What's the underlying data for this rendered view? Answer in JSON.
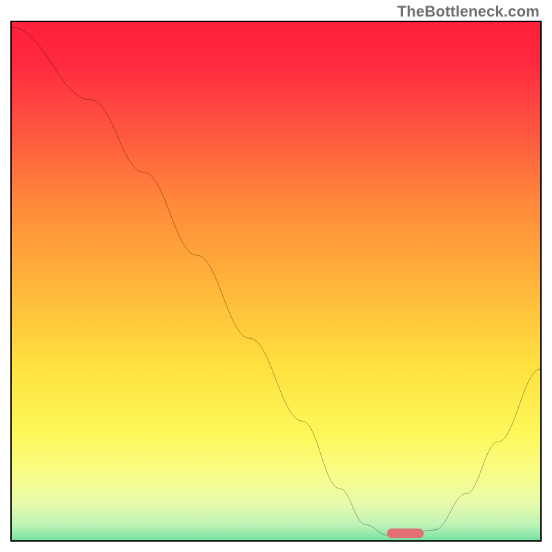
{
  "watermark": "TheBottleneck.com",
  "chart_data": {
    "type": "line",
    "title": "",
    "xlabel": "",
    "ylabel": "",
    "x_range": [
      0,
      100
    ],
    "y_range": [
      0,
      100
    ],
    "curve": {
      "x": [
        0,
        15,
        25,
        35,
        45,
        55,
        62,
        67,
        71,
        74,
        80,
        86,
        92,
        100
      ],
      "y": [
        99,
        85,
        71,
        55,
        39,
        23,
        10,
        3,
        1,
        1,
        2,
        9,
        19,
        33
      ]
    },
    "marker": {
      "x_start": 71,
      "x_end": 78,
      "y": 1
    },
    "gradient_stops": [
      {
        "pos": 0.0,
        "color": "#ff1f3a"
      },
      {
        "pos": 0.08,
        "color": "#ff2a3f"
      },
      {
        "pos": 0.2,
        "color": "#ff5440"
      },
      {
        "pos": 0.35,
        "color": "#ff8b3a"
      },
      {
        "pos": 0.5,
        "color": "#ffb63a"
      },
      {
        "pos": 0.65,
        "color": "#ffe13f"
      },
      {
        "pos": 0.78,
        "color": "#fdf85a"
      },
      {
        "pos": 0.86,
        "color": "#f8fd8b"
      },
      {
        "pos": 0.91,
        "color": "#e8fbac"
      },
      {
        "pos": 0.95,
        "color": "#c0f3b6"
      },
      {
        "pos": 0.975,
        "color": "#86e6a7"
      },
      {
        "pos": 1.0,
        "color": "#1fc978"
      }
    ]
  }
}
